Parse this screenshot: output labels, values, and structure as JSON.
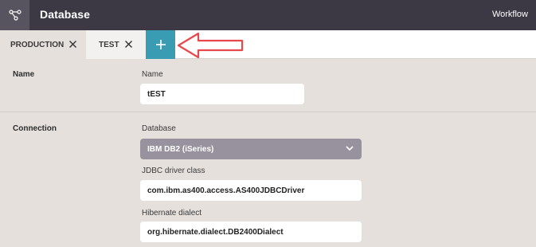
{
  "header": {
    "title": "Database",
    "workflow_label": "Workflow",
    "app_icon": "workflow-nodes-icon"
  },
  "tabs": [
    {
      "label": "PRODUCTION",
      "active": false
    },
    {
      "label": "TEST",
      "active": true
    }
  ],
  "add_tab_icon": "plus-icon",
  "colors": {
    "header_bg": "#3c3944",
    "accent": "#3a9cb3",
    "select_bg": "#98929e",
    "arrow": "#e8484c"
  },
  "name_section": {
    "label": "Name",
    "field_label": "Name",
    "value": "tEST"
  },
  "connection_section": {
    "label": "Connection",
    "database_label": "Database",
    "database_value": "IBM DB2 (iSeries)",
    "jdbc_label": "JDBC driver class",
    "jdbc_value": "com.ibm.as400.access.AS400JDBCDriver",
    "hibernate_label": "Hibernate dialect",
    "hibernate_value": "org.hibernate.dialect.DB2400Dialect"
  }
}
